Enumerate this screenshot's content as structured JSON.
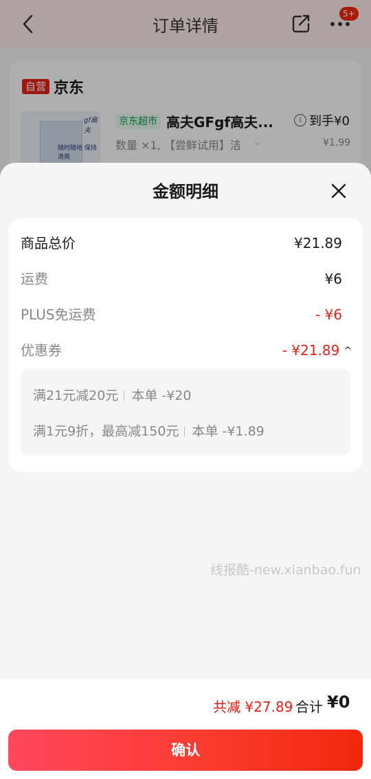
{
  "nav": {
    "title": "订单详情",
    "badge": "5+"
  },
  "order": {
    "self_tag": "自营",
    "shop_name": "京东",
    "product": {
      "brand_mark": "gf高夫",
      "image_text": "随时随地 保持清爽",
      "market_tag": "京东超市",
      "name": "高夫GFgf高夫...",
      "received_label": "到手¥0",
      "qty_text": "数量 ×1, 【尝鲜试用】洁",
      "unit_price": "¥1.99"
    }
  },
  "sheet": {
    "title": "金额明细",
    "rows": [
      {
        "label": "商品总价",
        "value": "¥21.89"
      },
      {
        "label": "运费",
        "value": "¥6"
      },
      {
        "label": "PLUS免运费",
        "value": "- ¥6"
      },
      {
        "label": "优惠券",
        "value": "- ¥21.89"
      }
    ],
    "coupons": [
      {
        "rule": "满21元减20元",
        "deduction": "本单 -¥20"
      },
      {
        "rule": "满1元9折，最高减150元",
        "deduction": "本单 -¥1.89"
      }
    ]
  },
  "watermark": "线报酷-new.xianbao.fun",
  "footer": {
    "savings": "共减 ¥27.89",
    "total_label": "合计",
    "total_value": "¥0",
    "confirm_label": "确认"
  },
  "colors": {
    "accent_red": "#e2231a",
    "button_gradient_start": "#ff475d",
    "button_gradient_end": "#f2270c",
    "market_green": "#0a9a4a"
  }
}
